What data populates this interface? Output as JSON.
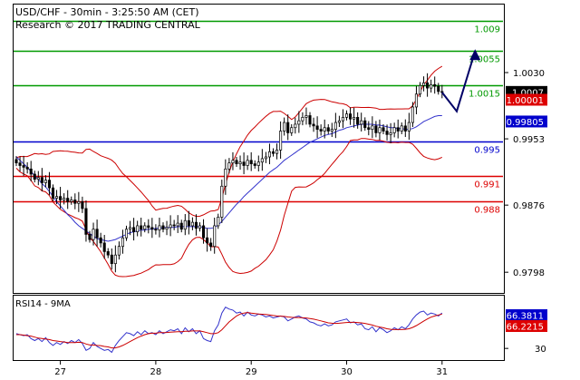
{
  "header": {
    "line1": "USD/CHF - 30min - 3:25:50 AM (CET)",
    "line2": "Research © 2017 TRADING CENTRAL"
  },
  "colors": {
    "green": "#009900",
    "blue": "#0000cc",
    "red": "#dd0000",
    "candle": "#000000",
    "bollinger": "#cc0000",
    "ma": "#3333cc",
    "arrow": "#000066"
  },
  "chart_data": [
    {
      "type": "line",
      "name": "price",
      "ylim": [
        0.9775,
        1.0108
      ],
      "yticks": [
        {
          "value": 1.003,
          "label": "1.0030"
        },
        {
          "value": 0.9953,
          "label": "0.9953"
        },
        {
          "value": 0.9876,
          "label": "0.9876"
        },
        {
          "value": 0.9798,
          "label": "0.9798"
        }
      ],
      "xticks": [
        {
          "index": 12,
          "label": "27"
        },
        {
          "index": 38,
          "label": "28"
        },
        {
          "index": 64,
          "label": "29"
        },
        {
          "index": 90,
          "label": "30"
        },
        {
          "index": 116,
          "label": "31"
        }
      ],
      "levels": [
        {
          "value": 1.009,
          "label": "1.009",
          "color": "green"
        },
        {
          "value": 1.0055,
          "label": "1.0055",
          "color": "green"
        },
        {
          "value": 1.0015,
          "label": "1.0015",
          "color": "green"
        },
        {
          "value": 0.995,
          "label": "0.995",
          "color": "blue"
        },
        {
          "value": 0.991,
          "label": "0.991",
          "color": "red"
        },
        {
          "value": 0.988,
          "label": "0.988",
          "color": "red"
        }
      ],
      "price_tags": [
        {
          "value": 1.0007,
          "label": "1.0007",
          "bg": "#000000",
          "fg": "#ffffff"
        },
        {
          "value": 1.0,
          "label": "1.00001",
          "bg": "#dd0000",
          "fg": "#ffffff"
        },
        {
          "value": 0.998,
          "label": "0.99805",
          "bg": "#0000cc",
          "fg": "#ffffff"
        }
      ],
      "close": [
        0.9925,
        0.9922,
        0.992,
        0.9918,
        0.9912,
        0.9906,
        0.9908,
        0.9902,
        0.9905,
        0.9896,
        0.9884,
        0.9886,
        0.9882,
        0.9884,
        0.988,
        0.9882,
        0.9878,
        0.988,
        0.9872,
        0.9842,
        0.9836,
        0.9848,
        0.9838,
        0.9832,
        0.9822,
        0.9818,
        0.9808,
        0.9818,
        0.9828,
        0.9838,
        0.9848,
        0.985,
        0.9845,
        0.9852,
        0.9848,
        0.9852,
        0.985,
        0.9848,
        0.9847,
        0.9852,
        0.9848,
        0.985,
        0.9853,
        0.9852,
        0.9855,
        0.9848,
        0.9858,
        0.9852,
        0.9856,
        0.9849,
        0.9852,
        0.9838,
        0.9832,
        0.9828,
        0.9852,
        0.9862,
        0.9898,
        0.9918,
        0.9925,
        0.9928,
        0.9924,
        0.9926,
        0.9922,
        0.9928,
        0.9924,
        0.9922,
        0.9926,
        0.993,
        0.9932,
        0.9938,
        0.9936,
        0.994,
        0.9962,
        0.9972,
        0.996,
        0.9966,
        0.997,
        0.9974,
        0.9978,
        0.998,
        0.997,
        0.9968,
        0.9964,
        0.9962,
        0.9966,
        0.9962,
        0.9964,
        0.9972,
        0.9974,
        0.9978,
        0.9982,
        0.9976,
        0.9978,
        0.997,
        0.9974,
        0.9966,
        0.9964,
        0.9968,
        0.996,
        0.9966,
        0.9962,
        0.9958,
        0.996,
        0.9966,
        0.9962,
        0.9968,
        0.9962,
        0.9972,
        0.999,
        1.0005,
        1.0015,
        1.0018,
        1.0012,
        1.0016,
        1.0014,
        1.0008,
        1.0007
      ],
      "ma": [
        0.9932,
        0.9928,
        0.9924,
        0.992,
        0.9915,
        0.991,
        0.9906,
        0.9901,
        0.9897,
        0.9892,
        0.9886,
        0.988,
        0.9875,
        0.987,
        0.9865,
        0.9861,
        0.9856,
        0.9852,
        0.9849,
        0.9846,
        0.9843,
        0.984,
        0.9837,
        0.9836,
        0.9835,
        0.9834,
        0.9835,
        0.9836,
        0.9838,
        0.984,
        0.9842,
        0.9844,
        0.9845,
        0.9846,
        0.9847,
        0.9847,
        0.9848,
        0.9848,
        0.9849,
        0.9849,
        0.985,
        0.985,
        0.985,
        0.985,
        0.9851,
        0.9851,
        0.9851,
        0.9851,
        0.9851,
        0.9851,
        0.9851,
        0.985,
        0.9849,
        0.9849,
        0.985,
        0.9853,
        0.9857,
        0.9862,
        0.9867,
        0.9872,
        0.9877,
        0.9881,
        0.9886,
        0.989,
        0.9894,
        0.9898,
        0.9902,
        0.9906,
        0.991,
        0.9914,
        0.9917,
        0.992,
        0.9924,
        0.9928,
        0.9931,
        0.9934,
        0.9937,
        0.994,
        0.9943,
        0.9946,
        0.9949,
        0.9951,
        0.9953,
        0.9955,
        0.9957,
        0.9958,
        0.9959,
        0.9961,
        0.9963,
        0.9964,
        0.9966,
        0.9967,
        0.9968,
        0.9969,
        0.997,
        0.997,
        0.997,
        0.997,
        0.9969,
        0.9969,
        0.9968,
        0.9967,
        0.9966,
        0.9966,
        0.9965,
        0.9965,
        0.9964,
        0.9964,
        0.9965,
        0.9967,
        0.997,
        0.9973,
        0.9975,
        0.9977,
        0.9979,
        0.998,
        0.998
      ],
      "forecast": [
        {
          "index": 116,
          "value": 1.0007
        },
        {
          "index": 120,
          "value": 0.9985
        },
        {
          "index": 125,
          "value": 1.0055
        }
      ]
    },
    {
      "type": "line",
      "name": "RSI14 - 9MA",
      "ylim": [
        20,
        80
      ],
      "yticks": [
        {
          "value": 30,
          "label": "30"
        }
      ],
      "price_tags": [
        {
          "value": 66.3811,
          "label": "66.3811",
          "bg": "#0000cc",
          "fg": "#ffffff"
        },
        {
          "value": 66.2215,
          "label": "66.2215",
          "bg": "#dd0000",
          "fg": "#ffffff"
        }
      ],
      "rsi": [
        45,
        44,
        43,
        44,
        40,
        38,
        40,
        37,
        41,
        36,
        33,
        36,
        34,
        37,
        35,
        38,
        36,
        39,
        35,
        28,
        30,
        36,
        32,
        30,
        28,
        29,
        26,
        33,
        38,
        42,
        46,
        45,
        43,
        47,
        44,
        48,
        45,
        46,
        44,
        48,
        45,
        47,
        49,
        48,
        50,
        45,
        51,
        47,
        50,
        45,
        48,
        40,
        38,
        37,
        48,
        54,
        66,
        72,
        70,
        69,
        66,
        67,
        63,
        67,
        64,
        63,
        65,
        64,
        62,
        63,
        61,
        62,
        63,
        62,
        58,
        60,
        62,
        63,
        61,
        60,
        57,
        56,
        54,
        53,
        55,
        53,
        54,
        57,
        58,
        59,
        60,
        56,
        57,
        54,
        55,
        50,
        49,
        52,
        47,
        51,
        49,
        46,
        48,
        51,
        49,
        52,
        50,
        54,
        60,
        64,
        67,
        68,
        64,
        66,
        65,
        63,
        66
      ],
      "rsi_ma": [
        44,
        44,
        43.5,
        43,
        42.5,
        41.5,
        40.5,
        40,
        39.5,
        39,
        38,
        37.5,
        37,
        36.5,
        36,
        36,
        36,
        36.2,
        36,
        34.5,
        33.5,
        33.5,
        33,
        32.8,
        32,
        31.5,
        30.5,
        30.5,
        31.5,
        33,
        35,
        37,
        39,
        41,
        42.5,
        44,
        45,
        45.5,
        45.5,
        46,
        46,
        46.2,
        46.5,
        46.8,
        47,
        47,
        47.5,
        47.5,
        47.8,
        47.8,
        47.8,
        47,
        46,
        45,
        45,
        46,
        49,
        53,
        57,
        60,
        63,
        65,
        66,
        66.5,
        66,
        65.5,
        65,
        64.8,
        64.5,
        64,
        63.5,
        63,
        62.8,
        62.6,
        62,
        61.6,
        61.4,
        61.4,
        61.2,
        61,
        60.4,
        59.8,
        59,
        58,
        57,
        56,
        55.6,
        55.4,
        55.6,
        56,
        56.4,
        56.6,
        56.6,
        56.4,
        56,
        55.4,
        54.6,
        53.8,
        52.6,
        51.8,
        51,
        50,
        49.4,
        49.2,
        49.2,
        49.2,
        49.4,
        50,
        51.4,
        53.2,
        55.4,
        57.8,
        60,
        61.8,
        63,
        64,
        65
      ]
    }
  ]
}
